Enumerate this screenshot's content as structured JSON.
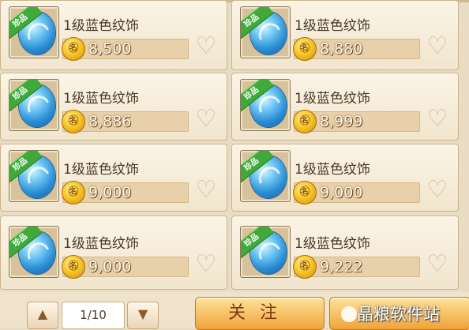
{
  "items": [
    {
      "badge": "珍品",
      "name": "1级蓝色纹饰",
      "price": "8,500",
      "coin_glyph": "㊔"
    },
    {
      "badge": "珍品",
      "name": "1级蓝色纹饰",
      "price": "8,880",
      "coin_glyph": "㊔"
    },
    {
      "badge": "珍品",
      "name": "1级蓝色纹饰",
      "price": "8,886",
      "coin_glyph": "㊔"
    },
    {
      "badge": "珍品",
      "name": "1级蓝色纹饰",
      "price": "8,999",
      "coin_glyph": "㊔"
    },
    {
      "badge": "珍品",
      "name": "1级蓝色纹饰",
      "price": "9,000",
      "coin_glyph": "㊔"
    },
    {
      "badge": "珍品",
      "name": "1级蓝色纹饰",
      "price": "9,000",
      "coin_glyph": "㊔"
    },
    {
      "badge": "珍品",
      "name": "1级蓝色纹饰",
      "price": "9,000",
      "coin_glyph": "㊔"
    },
    {
      "badge": "珍品",
      "name": "1级蓝色纹饰",
      "price": "9,222",
      "coin_glyph": "㊔"
    }
  ],
  "pagination": {
    "prev_glyph": "▲",
    "next_glyph": "▼",
    "page": "1/10"
  },
  "actions": {
    "follow_label": "关注"
  },
  "watermark": {
    "text": "晶粮软件站"
  },
  "icons": {
    "heart": "heart-icon",
    "coin": "coin-icon",
    "gem": "blue-gem-icon"
  },
  "colors": {
    "badge_green": "#3faa3a",
    "button_orange": "#f0a33a",
    "card_bg": "#fbf4e6"
  }
}
